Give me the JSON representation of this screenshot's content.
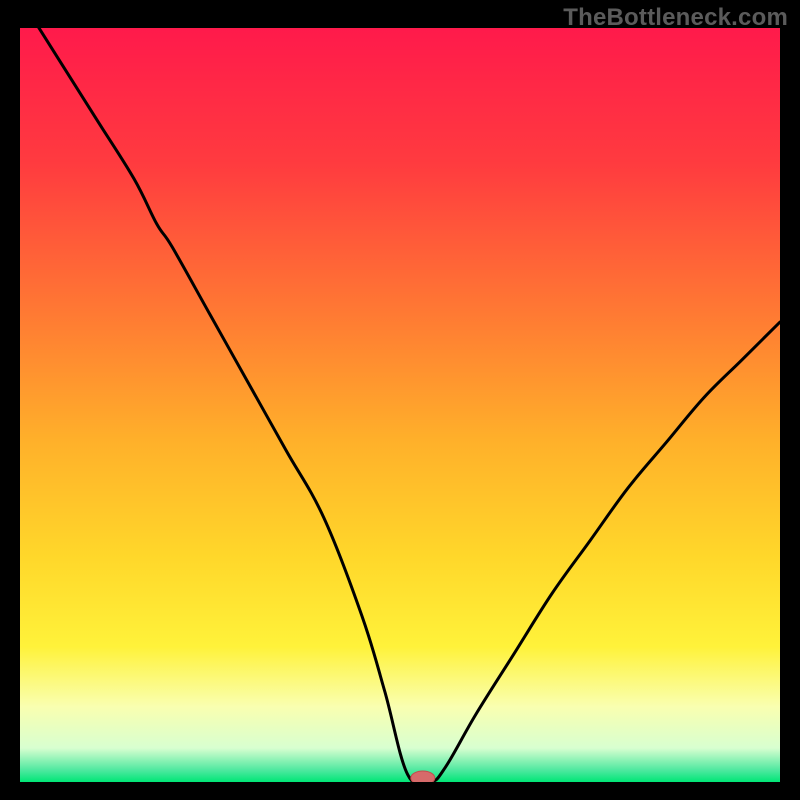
{
  "attribution": "TheBottleneck.com",
  "colors": {
    "frame": "#000000",
    "attribution_text": "#5b5b5b",
    "curve": "#000000",
    "min_marker_fill": "#d66a6a",
    "min_marker_stroke": "#c24d4d",
    "gradient_stops": [
      {
        "offset": 0.0,
        "color": "#ff1a4b"
      },
      {
        "offset": 0.18,
        "color": "#ff3b3f"
      },
      {
        "offset": 0.38,
        "color": "#ff7a33"
      },
      {
        "offset": 0.55,
        "color": "#ffb12a"
      },
      {
        "offset": 0.7,
        "color": "#ffd72a"
      },
      {
        "offset": 0.82,
        "color": "#fff23a"
      },
      {
        "offset": 0.9,
        "color": "#f9ffb0"
      },
      {
        "offset": 0.955,
        "color": "#d8ffd0"
      },
      {
        "offset": 0.985,
        "color": "#4be89e"
      },
      {
        "offset": 1.0,
        "color": "#00e676"
      }
    ]
  },
  "chart_data": {
    "type": "line",
    "title": "",
    "xlabel": "",
    "ylabel": "",
    "xlim": [
      0,
      100
    ],
    "ylim": [
      0,
      100
    ],
    "grid": false,
    "legend": false,
    "series": [
      {
        "name": "bottleneck-curve",
        "x": [
          0,
          5,
          10,
          15,
          18,
          20,
          25,
          30,
          35,
          40,
          45,
          48,
          51,
          54,
          56,
          60,
          65,
          70,
          75,
          80,
          85,
          90,
          95,
          100
        ],
        "values": [
          104,
          96,
          88,
          80,
          74,
          71,
          62,
          53,
          44,
          35,
          22,
          12,
          1,
          0,
          2,
          9,
          17,
          25,
          32,
          39,
          45,
          51,
          56,
          61
        ]
      }
    ],
    "min_marker": {
      "x": 53,
      "y": 0
    },
    "note": "Values read off the figure: y is visual height as % of plot (0 at bottom green band, 100 at top). Curve starts off the top-left edge (~104) and descends steeply to a flat minimum near x≈53, then rises more gently toward the right."
  }
}
